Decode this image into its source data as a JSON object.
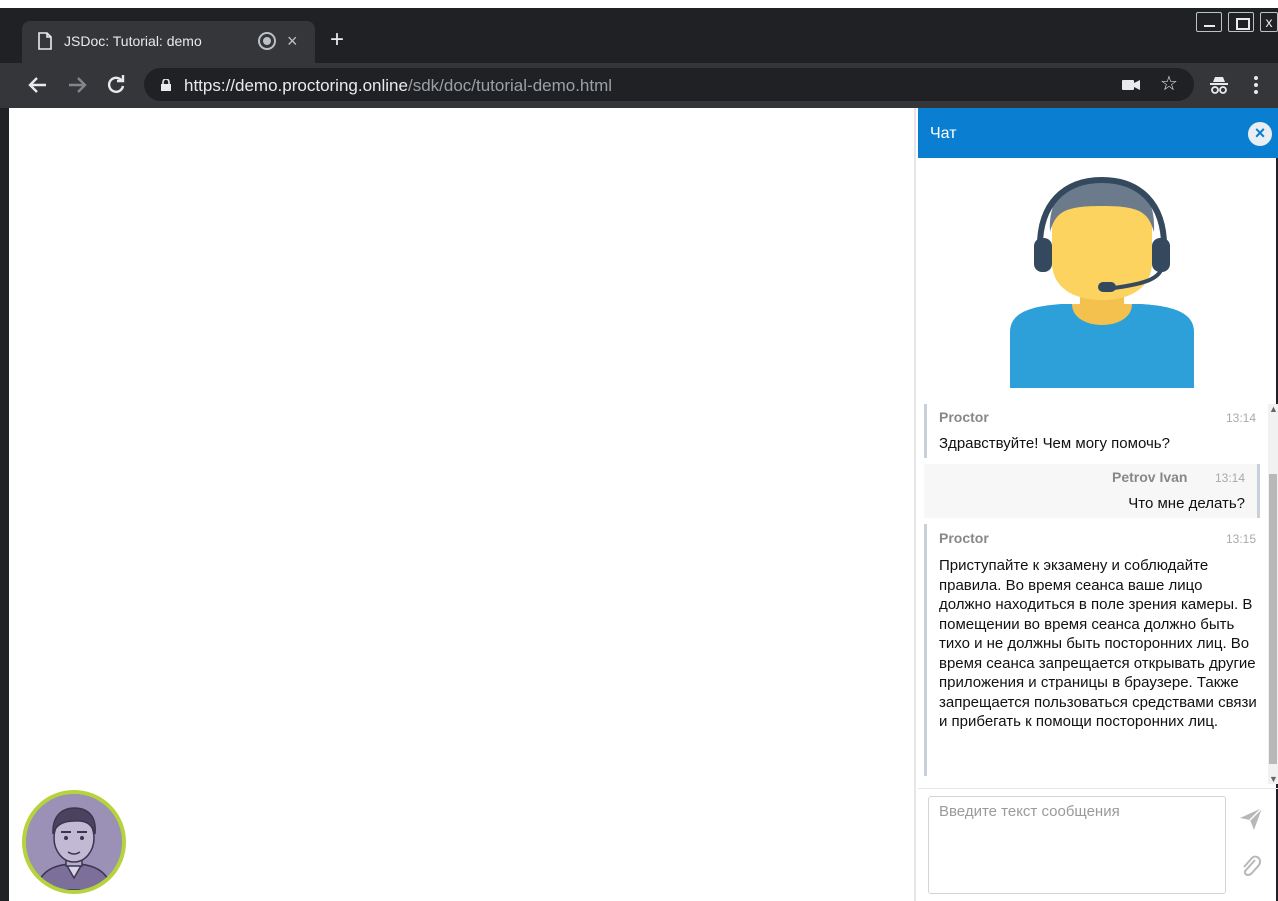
{
  "browser": {
    "tab_title": "JSDoc: Tutorial: demo",
    "tab_close": "×",
    "new_tab": "+",
    "window_close": "x",
    "url_host": "https://demo.proctoring.online",
    "url_path": "/sdk/doc/tutorial-demo.html",
    "bookmark_star": "☆"
  },
  "chat": {
    "title": "Чат",
    "close": "×",
    "messages": [
      {
        "author": "Proctor",
        "time": "13:14",
        "text": "Здравствуйте! Чем могу помочь?"
      },
      {
        "author": "Petrov Ivan",
        "time": "13:14",
        "text": "Что мне делать?"
      },
      {
        "author": "Proctor",
        "time": "13:15",
        "text": "Приступайте к экзамену и соблюдайте правила. Во время сеанса ваше лицо должно находиться в поле зрения камеры. В помещении во время сеанса должно быть тихо и не должны быть посторонних лиц. Во время сеанса запрещается открывать другие приложения и страницы в браузере. Также запрещается пользоваться средствами связи и прибегать к помощи посторонних лиц."
      }
    ],
    "input_placeholder": "Введите текст сообщения",
    "scroll_up": "▲",
    "scroll_down": "▼"
  },
  "colors": {
    "chat_header": "#0a7fd2",
    "avatar_ring": "#b5d33a",
    "chrome_dark": "#202124",
    "chrome_toolbar": "#35363a"
  }
}
